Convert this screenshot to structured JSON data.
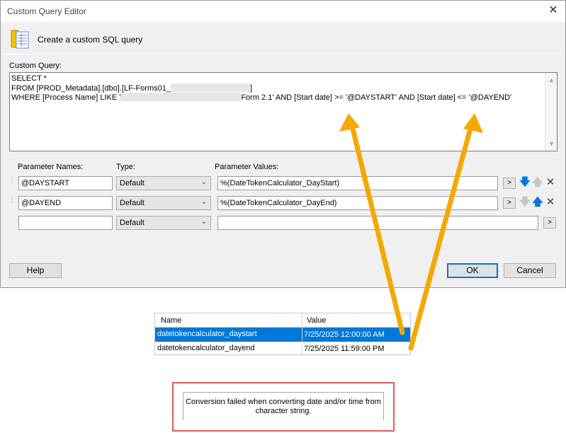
{
  "window": {
    "title": "Custom Query Editor"
  },
  "header": {
    "text": "Create a custom SQL query"
  },
  "query": {
    "label": "Custom Query:",
    "line1": "SELECT *",
    "line2_prefix": "FROM [PROD_Metadata].[dbo].[LF-Forms01_",
    "line2_suffix": "]",
    "line3_prefix": "WHERE [Process Name] LIKE '",
    "line3_suffix": "Form 2.1' AND [Start date] >= '@DAYSTART' AND [Start date] <= '@DAYEND'"
  },
  "params": {
    "names_label": "Parameter Names:",
    "type_label": "Type:",
    "values_label": "Parameter Values:",
    "rows": [
      {
        "name": "@DAYSTART",
        "type": "Default",
        "value": "%(DateTokenCalculator_DayStart)"
      },
      {
        "name": "@DAYEND",
        "type": "Default",
        "value": "%(DateTokenCalculator_DayEnd)"
      },
      {
        "name": "",
        "type": "Default",
        "value": ""
      }
    ]
  },
  "buttons": {
    "help": "Help",
    "ok": "OK",
    "cancel": "Cancel"
  },
  "table": {
    "col_name": "Name",
    "col_value": "Value",
    "rows": [
      {
        "name": "datetokencalculator_daystart",
        "value": "7/25/2025 12:00:00 AM"
      },
      {
        "name": "datetokencalculator_dayend",
        "value": "7/25/2025 11:59:00 PM"
      }
    ]
  },
  "error": {
    "message": "Conversion failed when converting date and/or time from character string."
  },
  "colors": {
    "accent": "#0078d7",
    "arrow": "#f5a800",
    "error_border": "#e05a5a"
  }
}
